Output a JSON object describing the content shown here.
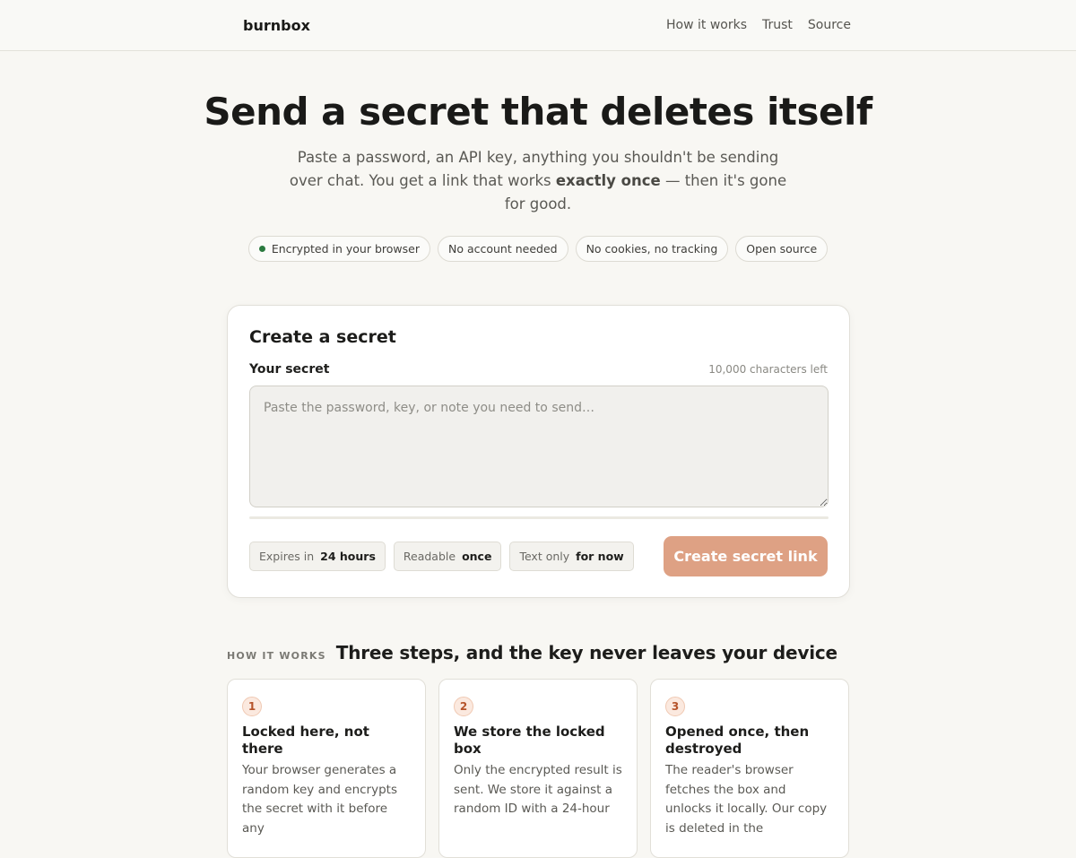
{
  "header": {
    "brand": "burnbox",
    "nav": [
      "How it works",
      "Trust",
      "Source"
    ]
  },
  "hero": {
    "title": "Send a secret that deletes itself",
    "subtitle_before": "Paste a password, an API key, anything you shouldn't be sending over chat. You get a link that works ",
    "subtitle_bold": "exactly once",
    "subtitle_after": " — then it's gone for good.",
    "pills": [
      "Encrypted in your browser",
      "No account needed",
      "No cookies, no tracking",
      "Open source"
    ],
    "status_dot_color": "#2a7a3f"
  },
  "create": {
    "title": "Create a secret",
    "field_label": "Your secret",
    "chars_left": "10,000 characters left",
    "placeholder": "Paste the password, key, or note you need to send…",
    "value": "",
    "options": [
      {
        "label": "Expires in",
        "value": "24 hours"
      },
      {
        "label": "Readable",
        "value": "once"
      },
      {
        "label": "Text only",
        "value": "for now"
      }
    ],
    "cta": "Create secret link",
    "cta_color": "#dea184"
  },
  "how": {
    "eyebrow": "HOW IT WORKS",
    "title": "Three steps, and the key never leaves your device",
    "steps": [
      {
        "num": "1",
        "title": "Locked here, not there",
        "text": "Your browser generates a random key and encrypts the secret with it before any"
      },
      {
        "num": "2",
        "title": "We store the locked box",
        "text": "Only the encrypted result is sent. We store it against a random ID with a 24-hour"
      },
      {
        "num": "3",
        "title": "Opened once, then destroyed",
        "text": "The reader's browser fetches the box and unlocks it locally. Our copy is deleted in the"
      }
    ]
  }
}
